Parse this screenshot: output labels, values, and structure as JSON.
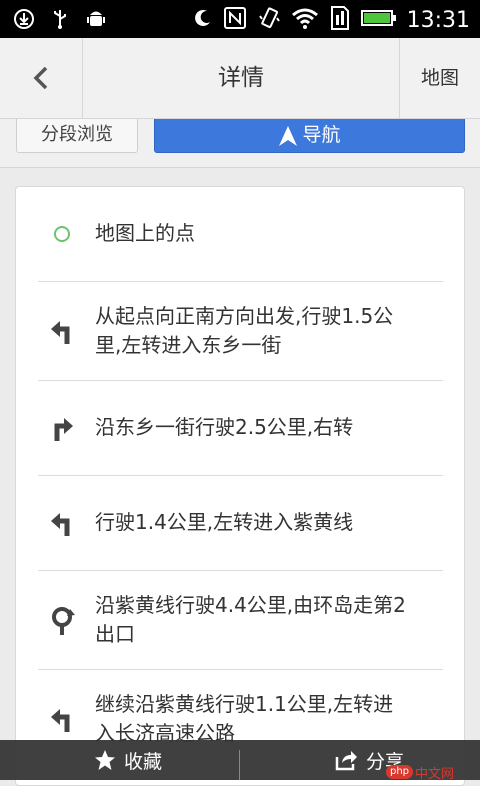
{
  "status_bar": {
    "time": "13:31",
    "left_icons": [
      "download-icon",
      "usb-icon",
      "android-debug-icon"
    ],
    "right_icons": [
      "moon-icon",
      "nfc-icon",
      "vibrate-icon",
      "wifi-icon",
      "sim-icon",
      "battery-icon"
    ]
  },
  "header": {
    "title": "详情",
    "map_label": "地图"
  },
  "actions": {
    "segment_label": "分段浏览",
    "navigate_label": "导航"
  },
  "route": {
    "steps": [
      {
        "icon": "circle-point-icon",
        "text": "地图上的点"
      },
      {
        "icon": "turn-left-icon",
        "text": "从起点向正南方向出发,行驶1.5公里,左转进入东乡一街"
      },
      {
        "icon": "turn-right-icon",
        "text": "沿东乡一街行驶2.5公里,右转"
      },
      {
        "icon": "turn-left-icon",
        "text": "行驶1.4公里,左转进入紫黄线"
      },
      {
        "icon": "roundabout-icon",
        "text": "沿紫黄线行驶4.4公里,由环岛走第2出口"
      },
      {
        "icon": "turn-left-icon",
        "text": "继续沿紫黄线行驶1.1公里,左转进入长济高速公路"
      }
    ]
  },
  "bottom_bar": {
    "favorite_label": "收藏",
    "share_label": "分享"
  },
  "watermark": {
    "badge": "php",
    "text": "中文网"
  },
  "colors": {
    "accent": "#3d79dd",
    "status_bar_bg": "#000000",
    "point_green": "#6cc36c"
  }
}
